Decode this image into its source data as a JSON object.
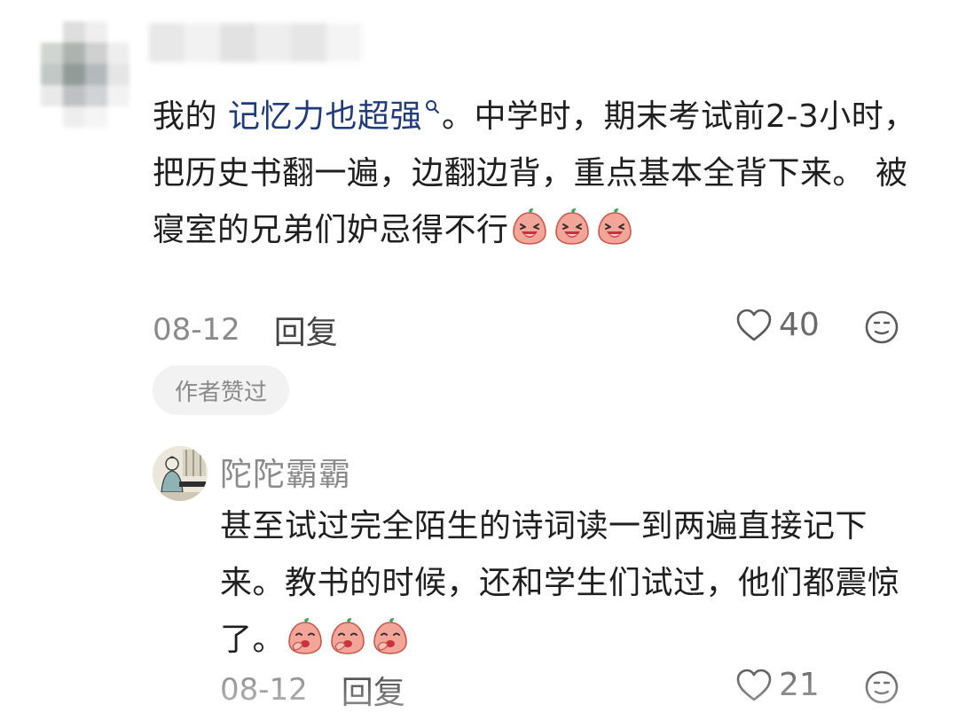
{
  "comments": [
    {
      "text_before": "我的 ",
      "keyword": "记忆力也超强",
      "text_after": "。中学时，期末考试前2-3小时，把历史书翻一遍，边翻边背，重点基本全背下来。 被寝室的兄弟们妒忌得不行",
      "emoji_name": "laughing-peach-emoji",
      "date": "08-12",
      "reply_label": "回复",
      "like_count": "40",
      "author_liked_badge": "作者赞过"
    },
    {
      "username": "陀陀霸霸",
      "text": "甚至试过完全陌生的诗词读一到两遍直接记下来。教书的时候，还和学生们试过，他们都震惊了。",
      "emoji_name": "giggling-peach-emoji",
      "date": "08-12",
      "reply_label": "回复",
      "like_count": "21"
    }
  ],
  "colors": {
    "keyword_link": "#1f3b7a",
    "meta_gray": "#8a8a8a",
    "badge_bg": "#f2f2f2"
  }
}
